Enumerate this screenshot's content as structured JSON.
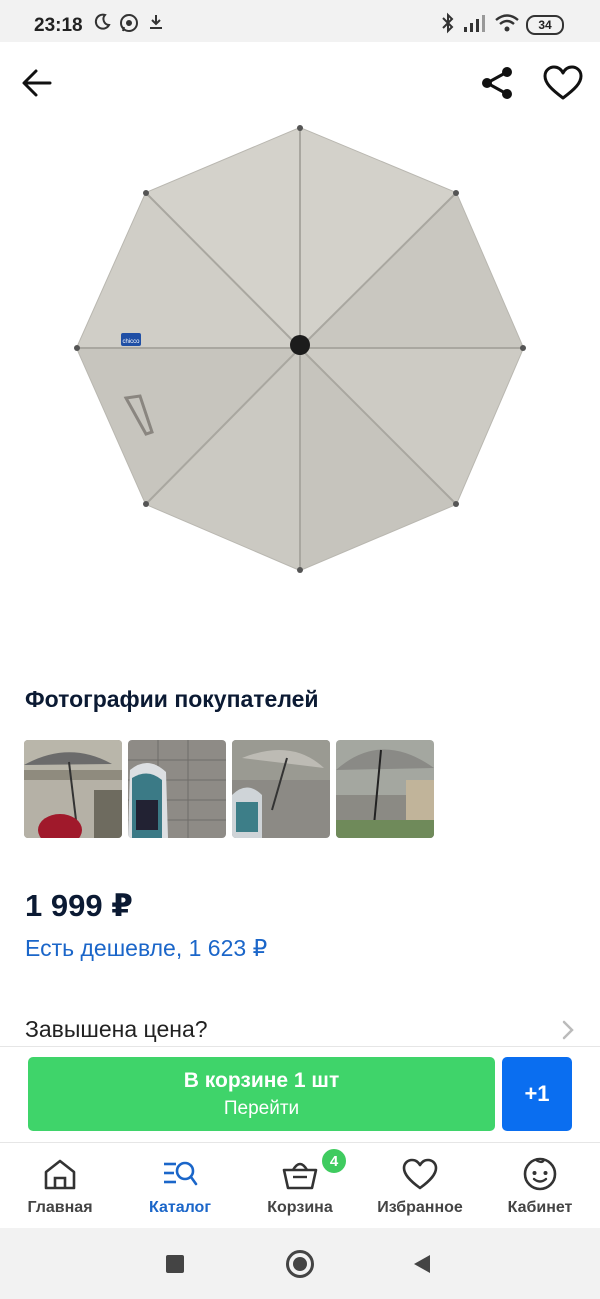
{
  "status_bar": {
    "time": "23:18",
    "battery": "34",
    "icons": [
      "moon-icon",
      "whatsapp-icon",
      "download-icon",
      "bluetooth-icon",
      "signal-icon",
      "wifi-icon",
      "battery-icon"
    ]
  },
  "app_bar": {
    "back_icon": "arrow-left-icon",
    "share_icon": "share-icon",
    "favorite_icon": "heart-icon"
  },
  "product": {
    "image_badge": "chicco",
    "customer_photos_title": "Фотографии покупателей",
    "photo_count": 4,
    "price": "1 999 ₽",
    "cheaper_link": "Есть дешевле, 1 623 ₽",
    "overpriced_label": "Завышена цена?"
  },
  "cart_bar": {
    "in_cart_label": "В корзине 1 шт",
    "go_label": "Перейти",
    "plus_label": "+1"
  },
  "bottom_nav": {
    "items": [
      {
        "label": "Главная",
        "icon": "home-icon"
      },
      {
        "label": "Каталог",
        "icon": "catalog-search-icon"
      },
      {
        "label": "Корзина",
        "icon": "basket-icon"
      },
      {
        "label": "Избранное",
        "icon": "heart-icon"
      },
      {
        "label": "Кабинет",
        "icon": "face-icon"
      }
    ],
    "active_index": 1,
    "cart_badge": "4"
  },
  "system_nav": {
    "icons": [
      "recents-square-icon",
      "home-circle-icon",
      "back-triangle-icon"
    ]
  },
  "colors": {
    "accent_blue": "#1b66c9",
    "cart_green": "#3fd46a",
    "plus_blue": "#0a6ef0",
    "badge_green": "#3fcb5f",
    "title_navy": "#0b1a33"
  }
}
